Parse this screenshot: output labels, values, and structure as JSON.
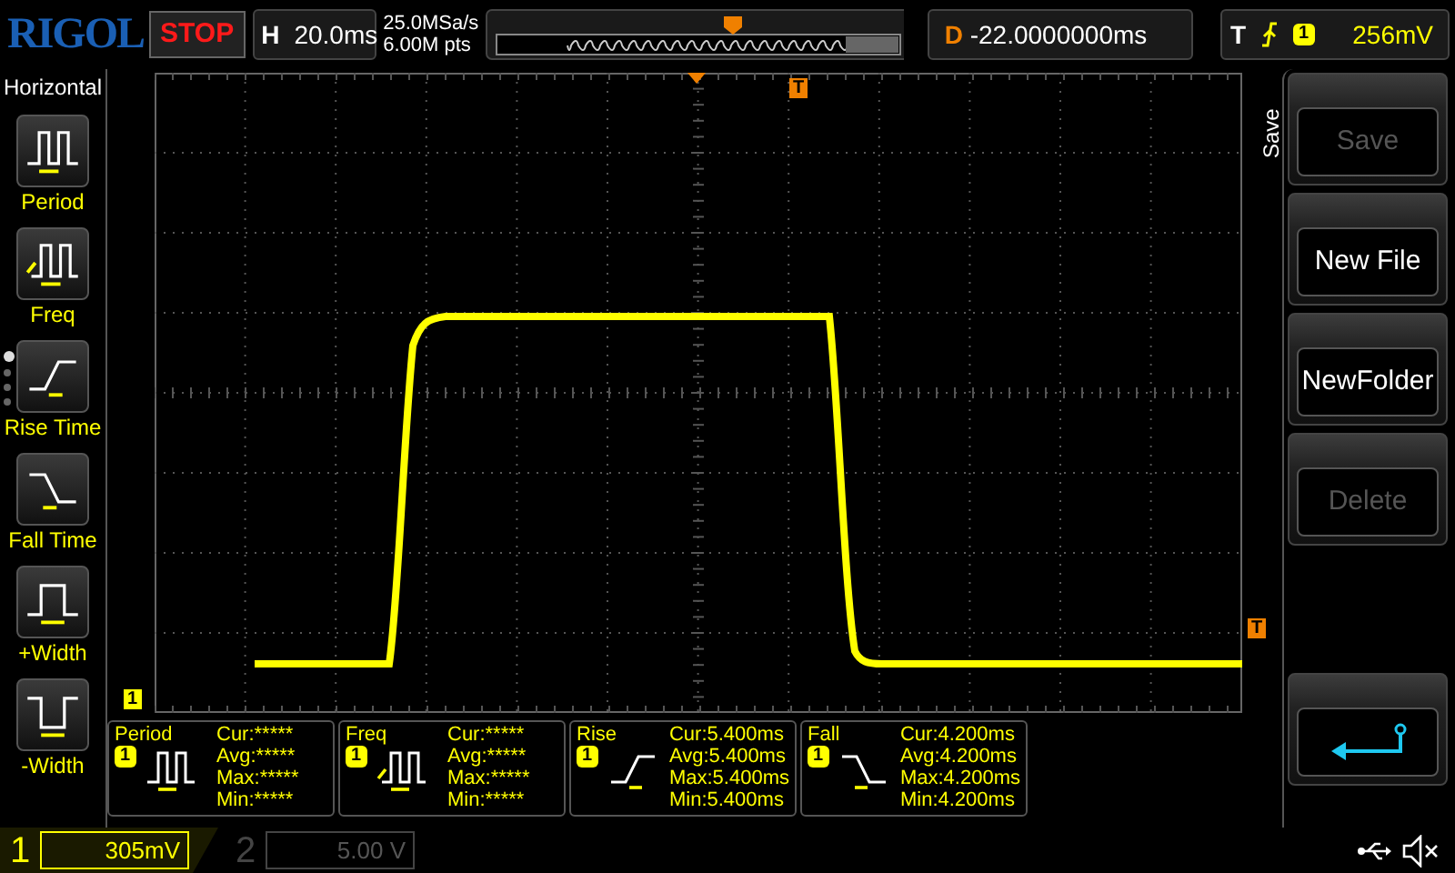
{
  "top_bar": {
    "logo": "RIGOL",
    "run_state": "STOP",
    "horizontal": {
      "label": "H",
      "timebase": "20.0ms"
    },
    "sample_rate": "25.0MSa/s",
    "memory_depth": "6.00M pts",
    "delay": {
      "label": "D",
      "value": "-22.0000000ms"
    },
    "trigger": {
      "label": "T",
      "channel": "1",
      "level": "256mV"
    }
  },
  "left_menu": {
    "title": "Horizontal",
    "items": [
      {
        "label": "Period",
        "kind": "period"
      },
      {
        "label": "Freq",
        "kind": "freq"
      },
      {
        "label": "Rise Time",
        "kind": "rise"
      },
      {
        "label": "Fall Time",
        "kind": "fall"
      },
      {
        "label": "+Width",
        "kind": "pwidth"
      },
      {
        "label": "-Width",
        "kind": "nwidth"
      }
    ],
    "pages": [
      {
        "selected": true
      },
      {
        "selected": false
      },
      {
        "selected": false
      },
      {
        "selected": false
      }
    ]
  },
  "screen": {
    "trigger_position_marker": "T",
    "channel_marker": "1",
    "trigger_level_marker": "T"
  },
  "right_menu": {
    "title": "Save",
    "items": [
      {
        "kind": "text",
        "label": "Save",
        "disabled": true
      },
      {
        "kind": "text",
        "label": "New File",
        "disabled": false
      },
      {
        "kind": "text",
        "label": "NewFolder",
        "disabled": false
      },
      {
        "kind": "text",
        "label": "Delete",
        "disabled": true
      },
      {
        "kind": "return",
        "disabled": false
      }
    ]
  },
  "measurements": [
    {
      "name": "Period",
      "channel": "1",
      "kind": "period",
      "lines": [
        "Cur:*****",
        "Avg:*****",
        "Max:*****",
        "Min:*****"
      ]
    },
    {
      "name": "Freq",
      "channel": "1",
      "kind": "freq",
      "lines": [
        "Cur:*****",
        "Avg:*****",
        "Max:*****",
        "Min:*****"
      ]
    },
    {
      "name": "Rise",
      "channel": "1",
      "kind": "rise",
      "lines": [
        "Cur:5.400ms",
        "Avg:5.400ms",
        "Max:5.400ms",
        "Min:5.400ms"
      ]
    },
    {
      "name": "Fall",
      "channel": "1",
      "kind": "fall",
      "lines": [
        "Cur:4.200ms",
        "Avg:4.200ms",
        "Max:4.200ms",
        "Min:4.200ms"
      ]
    }
  ],
  "bottom_bar": {
    "channels": [
      {
        "number": "1",
        "scale": "305mV",
        "active": true
      },
      {
        "number": "2",
        "scale": "5.00 V",
        "active": false
      }
    ]
  }
}
